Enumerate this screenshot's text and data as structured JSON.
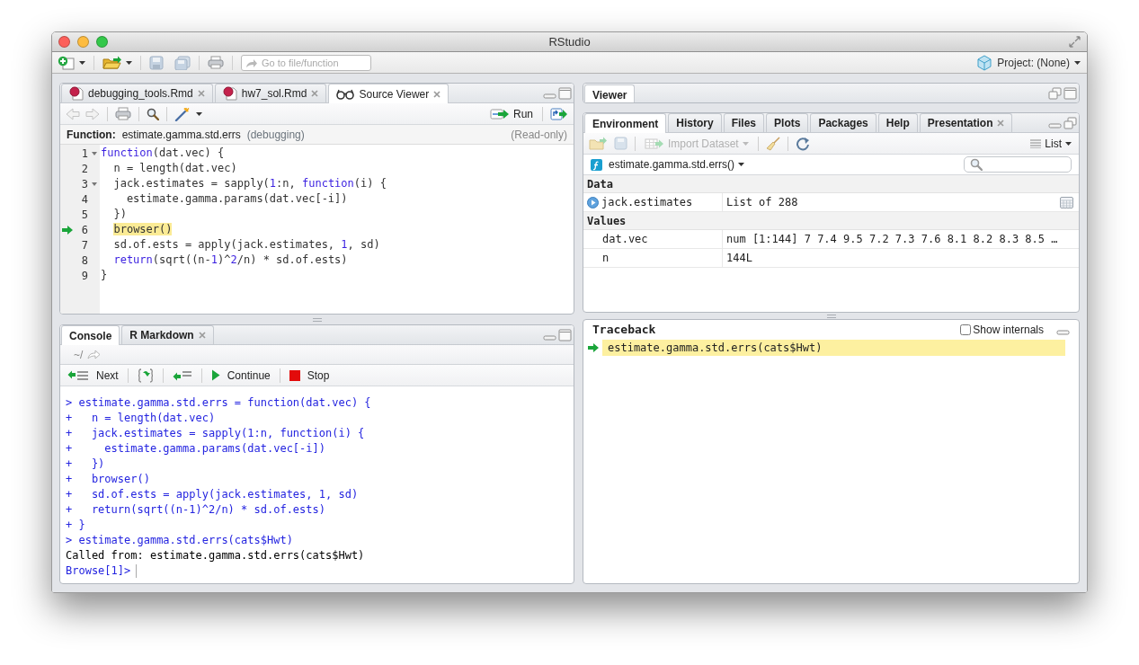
{
  "window": {
    "title": "RStudio"
  },
  "main_toolbar": {
    "goto_placeholder": "Go to file/function",
    "project": "Project: (None)"
  },
  "source_pane": {
    "tabs": [
      {
        "label": "debugging_tools.Rmd",
        "kind": "rmd",
        "selected": false,
        "closable": true
      },
      {
        "label": "hw7_sol.Rmd",
        "kind": "rmd",
        "selected": false,
        "closable": true
      },
      {
        "label": "Source Viewer",
        "kind": "viewer",
        "selected": true,
        "closable": true
      }
    ],
    "run_label": "Run",
    "info": {
      "label": "Function:",
      "name": "estimate.gamma.std.errs",
      "note": "(debugging)",
      "mode": "(Read-only)"
    },
    "lines": [
      {
        "number": "1",
        "foldable": true,
        "current": false,
        "parts": [
          {
            "text": "function",
            "kind": "keyword"
          },
          {
            "text": "(dat.vec) {",
            "kind": "plain"
          }
        ]
      },
      {
        "number": "2",
        "foldable": false,
        "current": false,
        "parts": [
          {
            "text": "  n = length(dat.vec)",
            "kind": "plain"
          }
        ]
      },
      {
        "number": "3",
        "foldable": true,
        "current": false,
        "parts": [
          {
            "text": "  jack.estimates = sapply(",
            "kind": "plain"
          },
          {
            "text": "1",
            "kind": "number"
          },
          {
            "text": ":n, ",
            "kind": "plain"
          },
          {
            "text": "function",
            "kind": "keyword"
          },
          {
            "text": "(i) {",
            "kind": "plain"
          }
        ]
      },
      {
        "number": "4",
        "foldable": false,
        "current": false,
        "parts": [
          {
            "text": "    estimate.gamma.params(dat.vec[-i])",
            "kind": "plain"
          }
        ]
      },
      {
        "number": "5",
        "foldable": false,
        "current": false,
        "parts": [
          {
            "text": "  })",
            "kind": "plain"
          }
        ]
      },
      {
        "number": "6",
        "foldable": false,
        "current": true,
        "parts": [
          {
            "text": "  browser()",
            "kind": "plain"
          }
        ]
      },
      {
        "number": "7",
        "foldable": false,
        "current": false,
        "parts": [
          {
            "text": "  sd.of.ests = apply(jack.estimates, ",
            "kind": "plain"
          },
          {
            "text": "1",
            "kind": "number"
          },
          {
            "text": ", sd)",
            "kind": "plain"
          }
        ]
      },
      {
        "number": "8",
        "foldable": false,
        "current": false,
        "parts": [
          {
            "text": "  return",
            "kind": "keyword"
          },
          {
            "text": "(sqrt((n-",
            "kind": "plain"
          },
          {
            "text": "1",
            "kind": "number"
          },
          {
            "text": ")^",
            "kind": "plain"
          },
          {
            "text": "2",
            "kind": "number"
          },
          {
            "text": "/n) * sd.of.ests)",
            "kind": "plain"
          }
        ]
      },
      {
        "number": "9",
        "foldable": false,
        "current": false,
        "parts": [
          {
            "text": "}",
            "kind": "plain"
          }
        ]
      }
    ]
  },
  "console_pane": {
    "tabs": [
      {
        "label": "Console",
        "selected": true,
        "closable": false
      },
      {
        "label": "R Markdown",
        "selected": false,
        "closable": true
      }
    ],
    "path": "~/",
    "debug_buttons": [
      {
        "label": "Next",
        "kind": "next"
      },
      {
        "kind": "step_into"
      },
      {
        "kind": "finish"
      },
      {
        "label": "Continue",
        "kind": "continue"
      },
      {
        "label": "Stop",
        "kind": "stop"
      }
    ],
    "lines": [
      {
        "text": "> estimate.gamma.std.errs = function(dat.vec) {",
        "kind": "input"
      },
      {
        "text": "+   n = length(dat.vec)",
        "kind": "input"
      },
      {
        "text": "+   jack.estimates = sapply(1:n, function(i) {",
        "kind": "input"
      },
      {
        "text": "+     estimate.gamma.params(dat.vec[-i])",
        "kind": "input"
      },
      {
        "text": "+   })",
        "kind": "input"
      },
      {
        "text": "+   browser()",
        "kind": "input"
      },
      {
        "text": "+   sd.of.ests = apply(jack.estimates, 1, sd)",
        "kind": "input"
      },
      {
        "text": "+   return(sqrt((n-1)^2/n) * sd.of.ests)",
        "kind": "input"
      },
      {
        "text": "+ }",
        "kind": "input"
      },
      {
        "text": "> estimate.gamma.std.errs(cats$Hwt)",
        "kind": "input"
      },
      {
        "text": "Called from: estimate.gamma.std.errs(cats$Hwt)",
        "kind": "output"
      }
    ],
    "prompt": "Browse[1]>"
  },
  "viewer_pane": {
    "tabs": [
      {
        "label": "Viewer",
        "selected": true,
        "closable": false
      }
    ]
  },
  "environment_pane": {
    "tabs": [
      {
        "label": "Environment",
        "selected": true,
        "closable": false
      },
      {
        "label": "History",
        "selected": false,
        "closable": false
      },
      {
        "label": "Files",
        "selected": false,
        "closable": false
      },
      {
        "label": "Plots",
        "selected": false,
        "closable": false
      },
      {
        "label": "Packages",
        "selected": false,
        "closable": false
      },
      {
        "label": "Help",
        "selected": false,
        "closable": false
      },
      {
        "label": "Presentation",
        "selected": false,
        "closable": true
      }
    ],
    "import_label": "Import Dataset",
    "import_disabled": true,
    "view_label": "List",
    "scope": "estimate.gamma.std.errs()",
    "sections": [
      {
        "title": "Data",
        "rows": [
          {
            "name": "jack.estimates",
            "value": "List of 288",
            "kind": "data"
          }
        ]
      },
      {
        "title": "Values",
        "rows": [
          {
            "name": "dat.vec",
            "value": "num [1:144] 7 7.4 9.5 7.2 7.3 7.6 8.1 8.2 8.3 8.5 …",
            "kind": "value"
          },
          {
            "name": "n",
            "value": "144L",
            "kind": "value"
          }
        ]
      }
    ]
  },
  "traceback_pane": {
    "title": "Traceback",
    "show_internals": {
      "label": "Show internals",
      "checked": false
    },
    "frames": [
      {
        "call": "estimate.gamma.std.errs(cats$Hwt)",
        "selected": true
      }
    ]
  }
}
